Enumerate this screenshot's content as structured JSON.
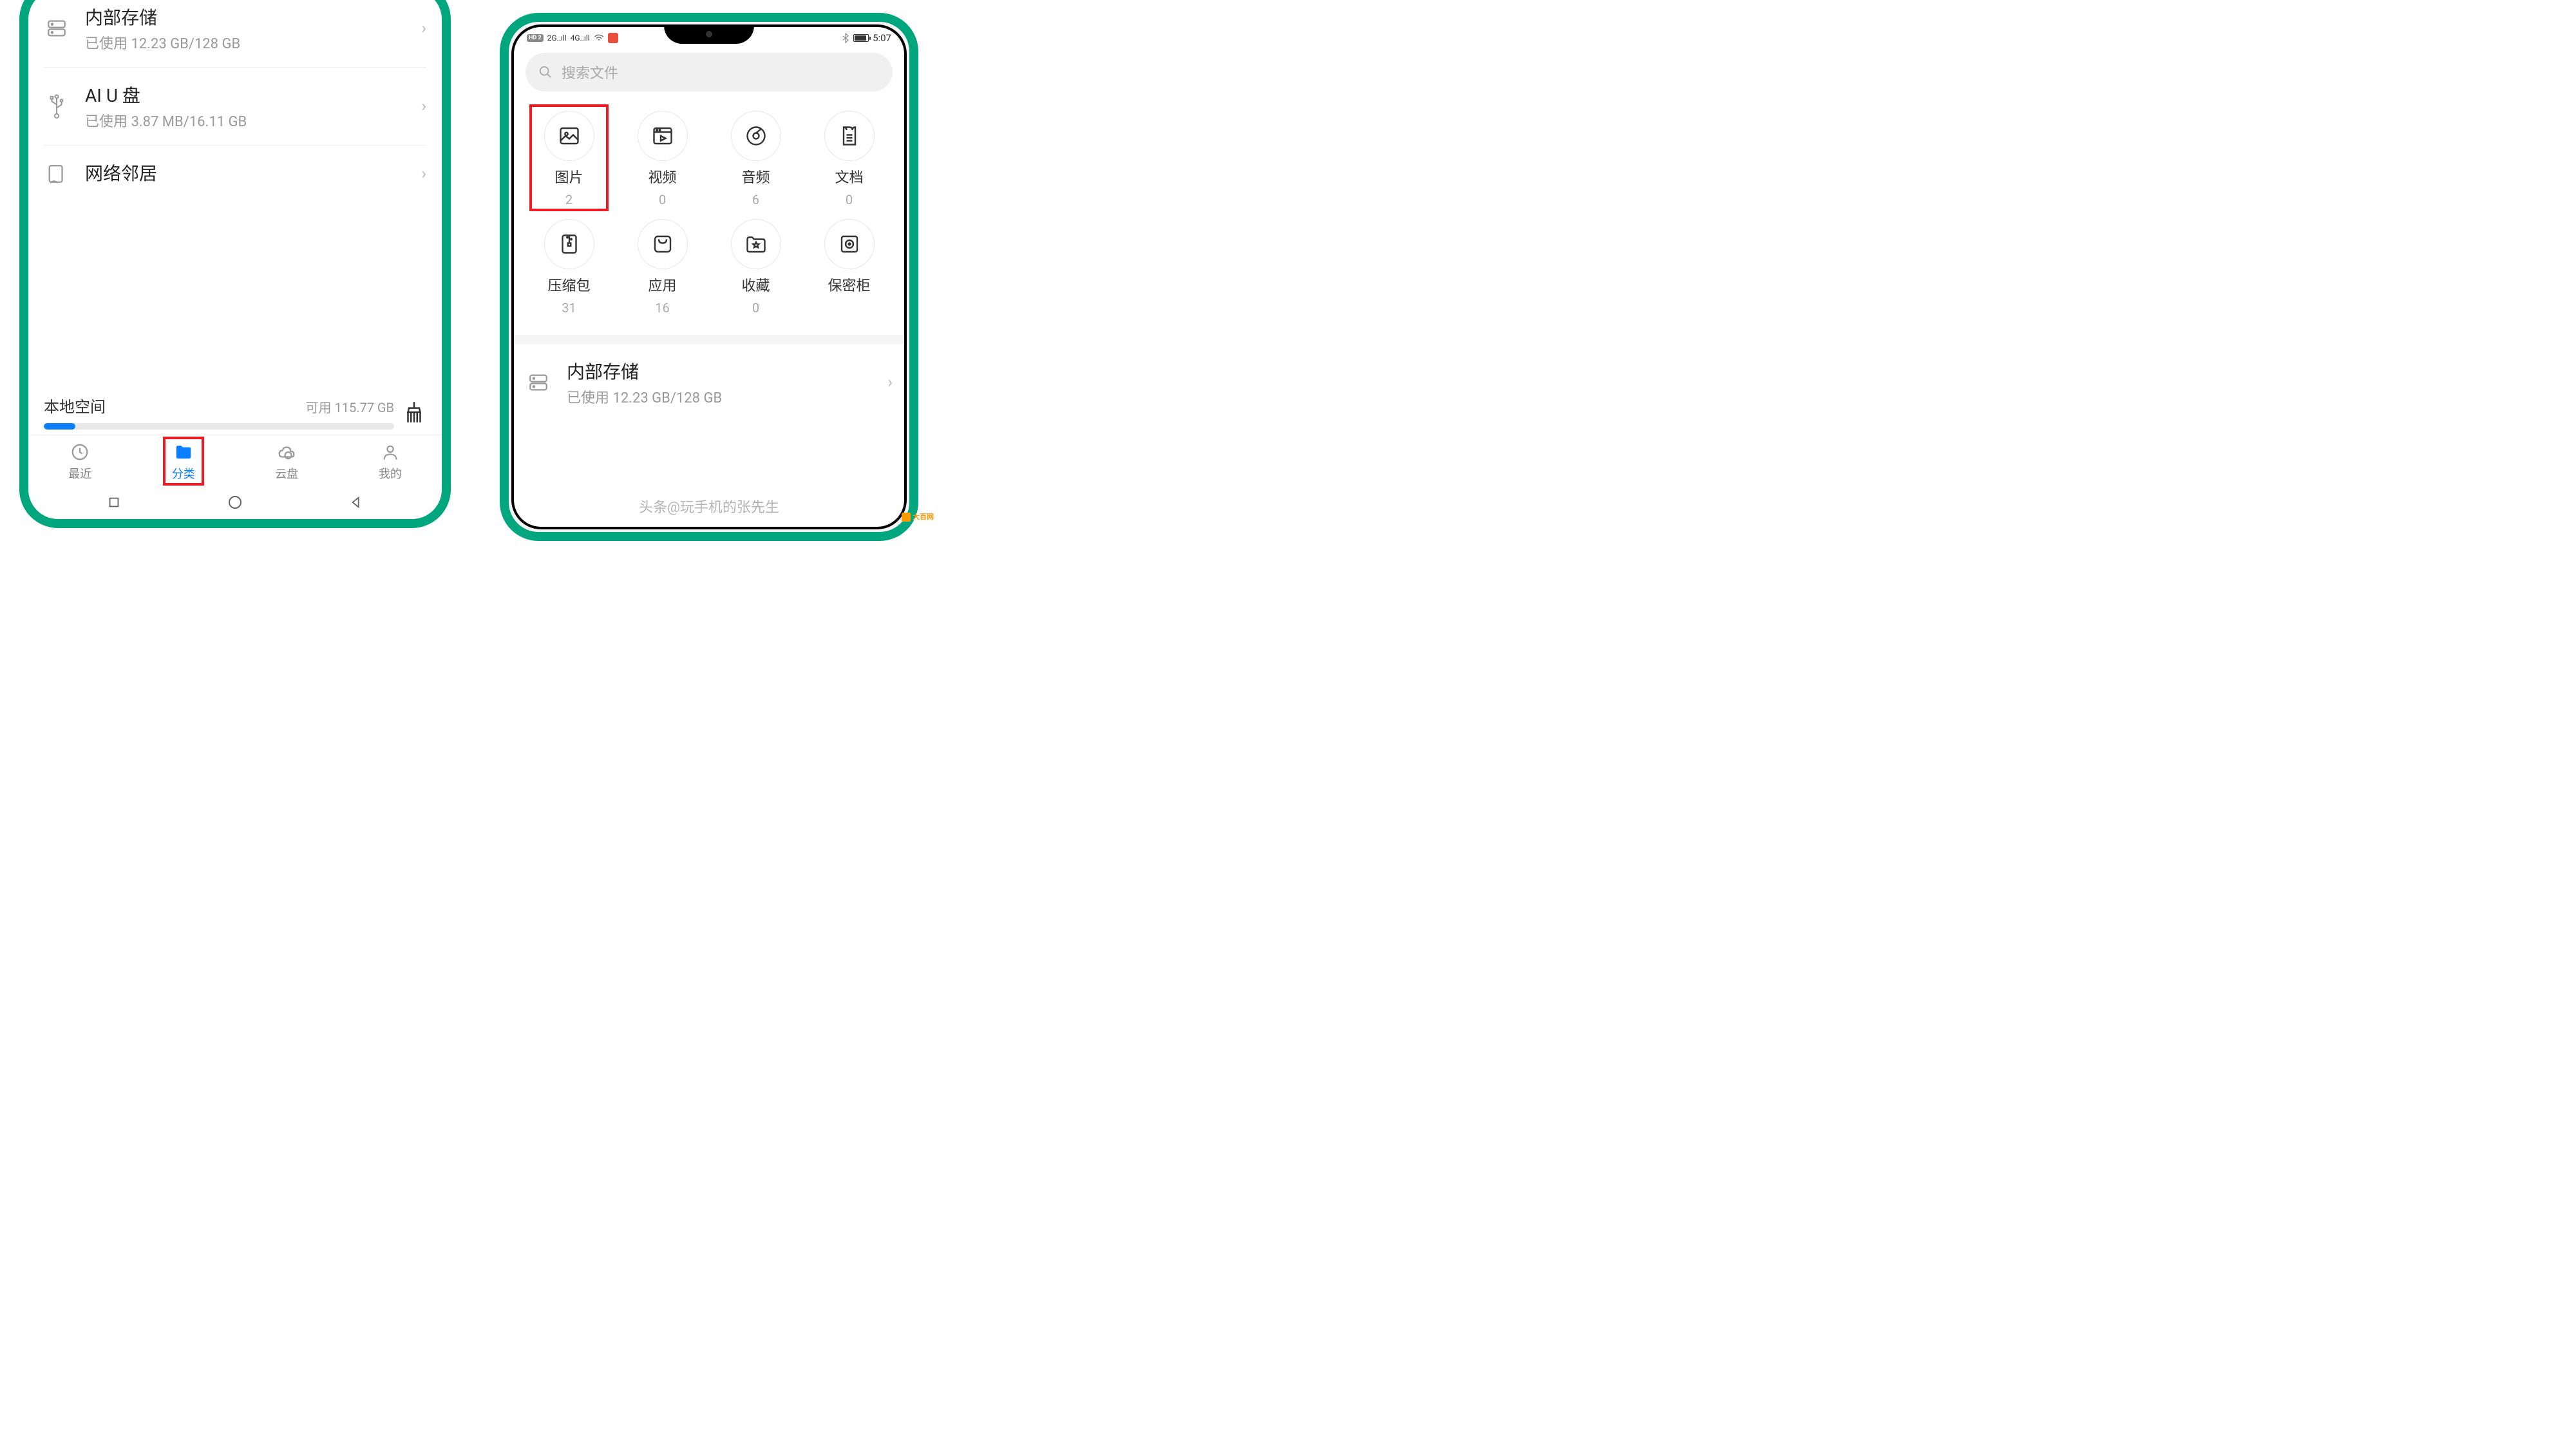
{
  "left": {
    "storage": [
      {
        "title": "内部存储",
        "sub": "已使用 12.23 GB/128 GB",
        "icon": "hdd"
      },
      {
        "title": "AI U 盘",
        "sub": "已使用 3.87 MB/16.11 GB",
        "icon": "usb"
      },
      {
        "title": "网络邻居",
        "sub": "",
        "icon": "nas"
      }
    ],
    "local": {
      "title": "本地空间",
      "avail": "可用 115.77 GB"
    },
    "tabs": [
      {
        "label": "最近",
        "icon": "clock"
      },
      {
        "label": "分类",
        "icon": "folder",
        "active": true
      },
      {
        "label": "云盘",
        "icon": "cloud"
      },
      {
        "label": "我的",
        "icon": "user"
      }
    ]
  },
  "right": {
    "status": {
      "time": "5:07",
      "hd": "HD 2",
      "net1": "2G",
      "net2": "4G"
    },
    "search": "搜索文件",
    "categories": [
      {
        "label": "图片",
        "count": "2",
        "icon": "image",
        "hl": true
      },
      {
        "label": "视频",
        "count": "0",
        "icon": "video"
      },
      {
        "label": "音频",
        "count": "6",
        "icon": "audio"
      },
      {
        "label": "文档",
        "count": "0",
        "icon": "doc"
      },
      {
        "label": "压缩包",
        "count": "31",
        "icon": "zip"
      },
      {
        "label": "应用",
        "count": "16",
        "icon": "app"
      },
      {
        "label": "收藏",
        "count": "0",
        "icon": "fav"
      },
      {
        "label": "保密柜",
        "count": "",
        "icon": "safe"
      }
    ],
    "storage": {
      "title": "内部存储",
      "sub": "已使用 12.23 GB/128 GB"
    }
  },
  "watermark": "头条@玩手机的张先生",
  "logo": "大百网"
}
